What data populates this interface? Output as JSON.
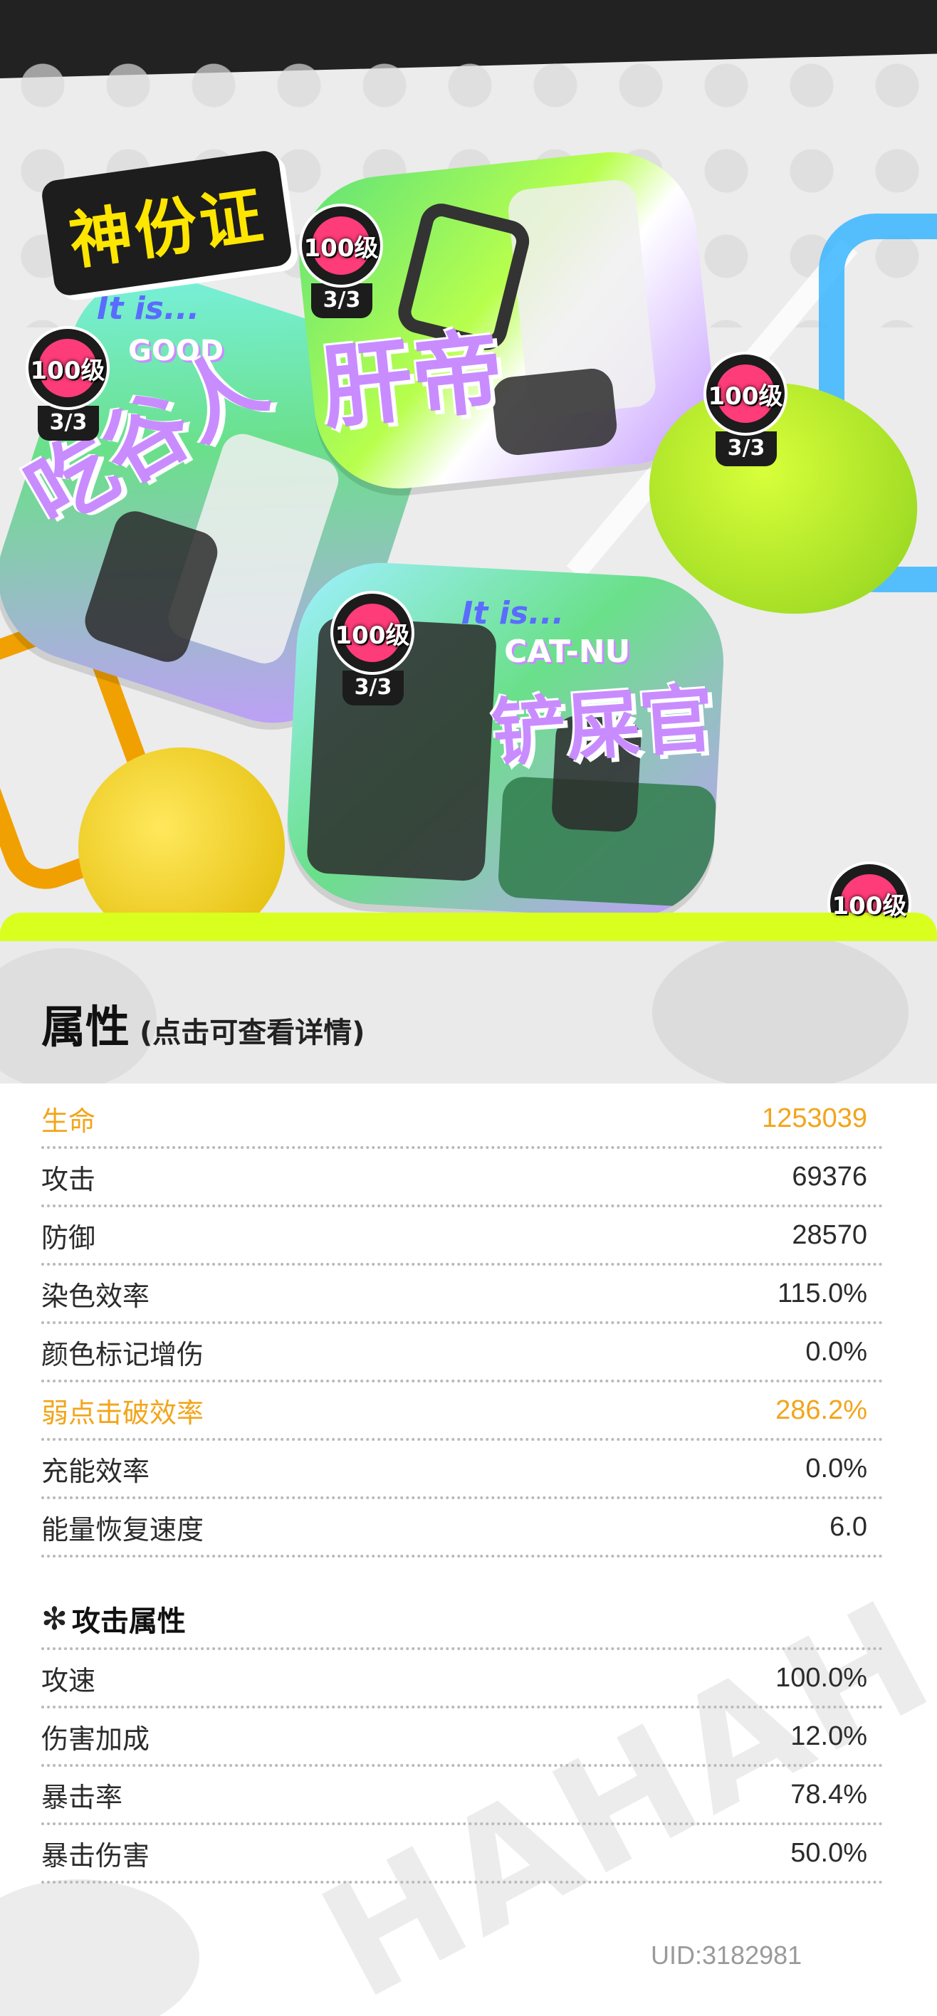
{
  "banner": {
    "title": "神份证",
    "cards": [
      {
        "top": "It is...",
        "tag": "GOOD",
        "name": "吃谷人"
      },
      {
        "top": "It is...",
        "tag": "",
        "name": "肝帝"
      },
      {
        "top": "It is...",
        "tag": "CAT-NU",
        "name": "铲屎官"
      }
    ],
    "levels": [
      {
        "level": "100级",
        "count": "3/3"
      },
      {
        "level": "100级",
        "count": "3/3"
      },
      {
        "level": "100级",
        "count": "3/3"
      },
      {
        "level": "100级",
        "count": "3/3"
      },
      {
        "level": "100级",
        "count": ""
      }
    ]
  },
  "attributes": {
    "title": "属性",
    "subtitle": "(点击可查看详情)",
    "basic": [
      {
        "label": "生命",
        "value": "1253039",
        "highlight": true
      },
      {
        "label": "攻击",
        "value": "69376",
        "highlight": false
      },
      {
        "label": "防御",
        "value": "28570",
        "highlight": false
      },
      {
        "label": "染色效率",
        "value": "115.0%",
        "highlight": false
      },
      {
        "label": "颜色标记增伤",
        "value": "0.0%",
        "highlight": false
      },
      {
        "label": "弱点击破效率",
        "value": "286.2%",
        "highlight": true
      },
      {
        "label": "充能效率",
        "value": "0.0%",
        "highlight": false
      },
      {
        "label": "能量恢复速度",
        "value": "6.0",
        "highlight": false
      }
    ],
    "attack_section_title": "攻击属性",
    "attack": [
      {
        "label": "攻速",
        "value": "100.0%"
      },
      {
        "label": "伤害加成",
        "value": "12.0%"
      },
      {
        "label": "暴击率",
        "value": "78.4%"
      },
      {
        "label": "暴击伤害",
        "value": "50.0%"
      }
    ],
    "accent_color": "#f2a51a"
  },
  "footer": {
    "uid": "UID:3182981",
    "bg_text": "HAHAH"
  }
}
